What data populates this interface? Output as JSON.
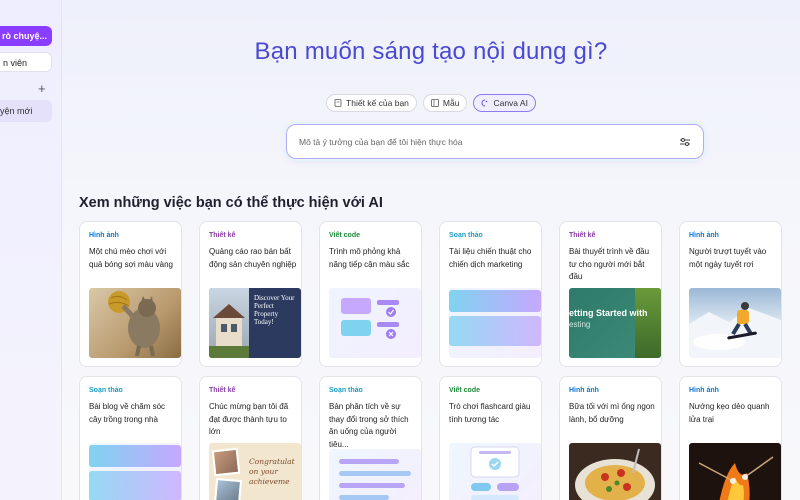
{
  "sidebar": {
    "active_item": "rò chuyệ...",
    "item2": "n viên",
    "plus": "+",
    "recent": "yện mới"
  },
  "hero": {
    "title": "Bạn muốn sáng tạo nội dung gì?"
  },
  "chips": [
    {
      "label": "Thiết kế của bạn",
      "icon": "document-icon"
    },
    {
      "label": "Mẫu",
      "icon": "template-icon"
    },
    {
      "label": "Canva AI",
      "icon": "canva-ai-icon",
      "active": true
    }
  ],
  "search": {
    "placeholder": "Mô tả ý tưởng của bạn để tôi hiện thực hóa"
  },
  "section_title": "Xem những việc bạn có thể thực hiện với AI",
  "cards": [
    {
      "category": "Hình ảnh",
      "description": "Một chú mèo chơi với quả bóng sợi màu vàng",
      "thumb": "cat-photo"
    },
    {
      "category": "Thiết kế",
      "description": "Quảng cáo rao bán bất động sản chuyên nghiệp",
      "thumb": "property-ad",
      "thumb_text": [
        "Discover Your",
        "Perfect",
        "Property",
        "Today!"
      ]
    },
    {
      "category": "Viết code",
      "description": "Trình mô phỏng khả năng tiếp cận màu sắc",
      "thumb": "code-ui"
    },
    {
      "category": "Soạn thảo",
      "description": "Tài liệu chiến thuật cho chiến dịch marketing",
      "thumb": "doc-ui"
    },
    {
      "category": "Thiết kế",
      "description": "Bài thuyết trình về đầu tư cho người mới bắt đầu",
      "thumb": "slide",
      "thumb_text": [
        "etting Started with",
        "esting"
      ]
    },
    {
      "category": "Hình ảnh",
      "description": "Người trượt tuyết vào một ngày tuyết rơi",
      "thumb": "snowboard-photo"
    },
    {
      "category": "Soạn thảo",
      "description": "Bài blog về chăm sóc cây trồng trong nhà",
      "thumb": "doc-ui"
    },
    {
      "category": "Thiết kế",
      "description": "Chúc mừng bạn tôi đã đạt được thành tựu to lớn",
      "thumb": "congrats-card",
      "thumb_text": [
        "Congratulat",
        "on your",
        "achieveme"
      ]
    },
    {
      "category": "Soạn thảo",
      "description": "Bản phân tích về sự thay đổi trong sở thích ăn uống của người tiêu...",
      "thumb": "doc-lines"
    },
    {
      "category": "Viết code",
      "description": "Trò chơi flashcard giàu tính tương tác",
      "thumb": "flashcard-ui"
    },
    {
      "category": "Hình ảnh",
      "description": "Bữa tối với mì ống ngon lành, bổ dưỡng",
      "thumb": "pasta-photo"
    },
    {
      "category": "Hình ảnh",
      "description": "Nướng kẹo dẻo quanh lửa trại",
      "thumb": "campfire-photo"
    }
  ],
  "colors": {
    "accent": "#8b3dff",
    "hero_title": "#4a49d3",
    "cat_image": "#0b78d1",
    "cat_design": "#8a3ea7",
    "cat_code": "#1d8a3a",
    "cat_write": "#1aa0c6"
  }
}
